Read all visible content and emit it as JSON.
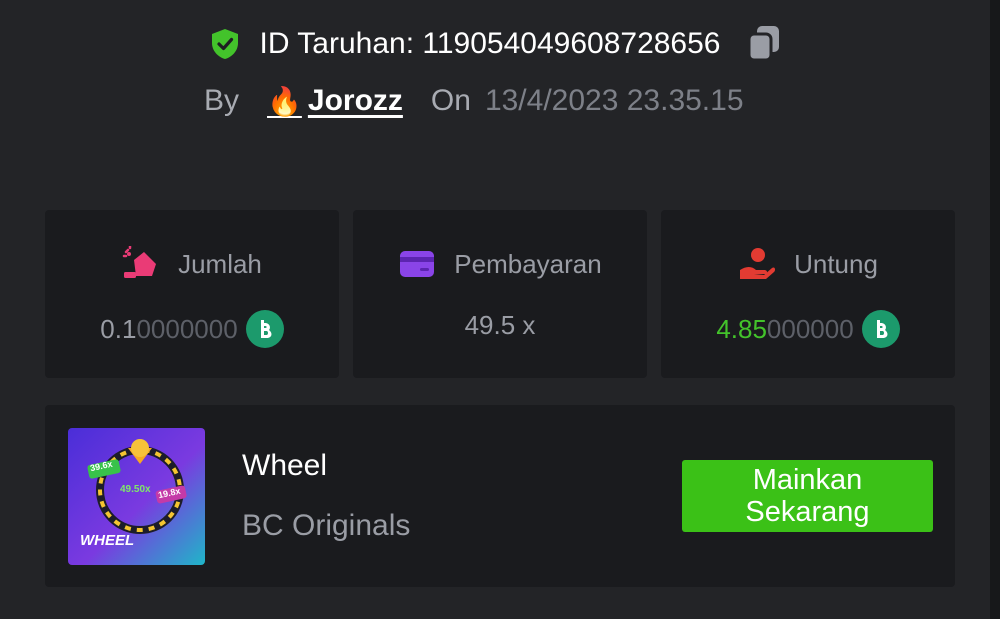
{
  "header": {
    "bet_id_label": "ID Taruhan:",
    "bet_id": "119054049608728656",
    "by_label": "By",
    "user_name": "Jorozz",
    "user_emoji": "🔥",
    "on_label": "On",
    "timestamp": "13/4/2023 23.35.15"
  },
  "stats": {
    "amount": {
      "label": "Jumlah",
      "value_main": "0.1",
      "value_dim": "0000000",
      "icon": "money-bag-icon",
      "icon_color": "#ea3b76",
      "coin": "bc-coin-icon"
    },
    "payout": {
      "label": "Pembayaran",
      "value": "49.5 x",
      "icon": "credit-card-icon",
      "icon_color": "#8a44e8"
    },
    "profit": {
      "label": "Untung",
      "value_main": "4.85",
      "value_dim": "000000",
      "icon": "hand-profit-icon",
      "icon_color": "#e23b32",
      "value_color": "#43c32b",
      "coin": "bc-coin-icon"
    }
  },
  "game": {
    "name": "Wheel",
    "provider": "BC Originals",
    "thumb_title": "WHEEL",
    "thumb_multipliers": [
      "39.6x",
      "49.50x",
      "19.8x"
    ],
    "play_button": "Mainkan Sekarang"
  },
  "colors": {
    "accent_green": "#3bc117",
    "shield_green": "#43c32b",
    "background": "#232427",
    "card": "#1a1b1e"
  }
}
